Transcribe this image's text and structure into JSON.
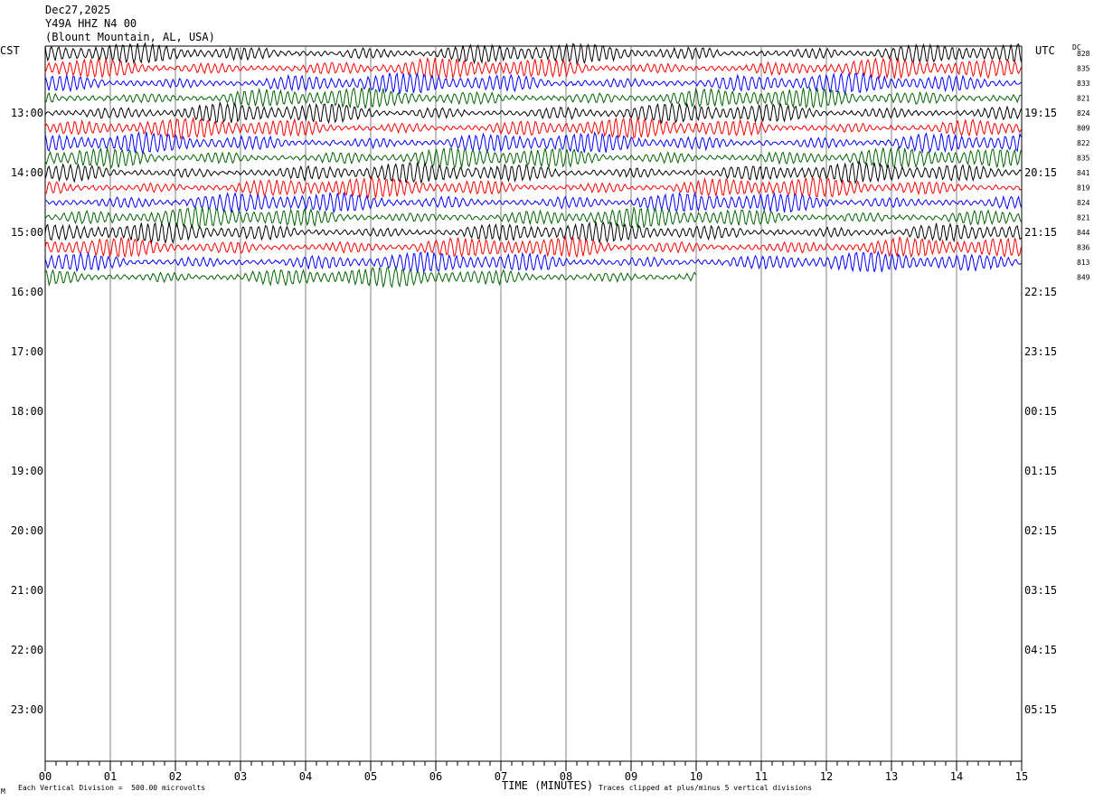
{
  "header": {
    "date": "Dec27,2025",
    "station": "Y49A HHZ N4 00",
    "location": "(Blount Mountain, AL, USA)"
  },
  "left_zone_label": "CST",
  "right_zone_label": "UTC",
  "dc_label": "DC",
  "footer": {
    "scale_note": "Each Vertical Division =  500.00 microvolts",
    "clip_note": "Traces clipped at plus/minus 5 vertical divisions",
    "corner_mark": "M"
  },
  "colors": {
    "trace_cycle": [
      "#000000",
      "#ff0000",
      "#0000ff",
      "#006400"
    ],
    "gridline": "#808080",
    "background": "#ffffff"
  },
  "chart_data": {
    "type": "line",
    "xlabel": "TIME (MINUTES)",
    "x_ticks": [
      "00",
      "01",
      "02",
      "03",
      "04",
      "05",
      "06",
      "07",
      "08",
      "09",
      "10",
      "11",
      "12",
      "13",
      "14",
      "15"
    ],
    "xlim": [
      0,
      15
    ],
    "y_left_labels": [
      "13:00",
      "14:00",
      "15:00",
      "16:00",
      "17:00",
      "18:00",
      "19:00",
      "20:00",
      "21:00",
      "22:00",
      "23:00"
    ],
    "y_right_labels": [
      "19:15",
      "20:15",
      "21:15",
      "22:15",
      "23:15",
      "00:15",
      "01:15",
      "02:15",
      "03:15",
      "04:15",
      "05:15"
    ],
    "dc_offsets": [
      "828",
      "835",
      "833",
      "821",
      "824",
      "809",
      "822",
      "835",
      "841",
      "819",
      "824",
      "821",
      "844",
      "836",
      "813",
      "849"
    ],
    "traces_total": 16,
    "last_trace_end_minute": 10.0,
    "traces_per_hour": 4,
    "first_trace_hour": "12:15",
    "grid": true
  }
}
